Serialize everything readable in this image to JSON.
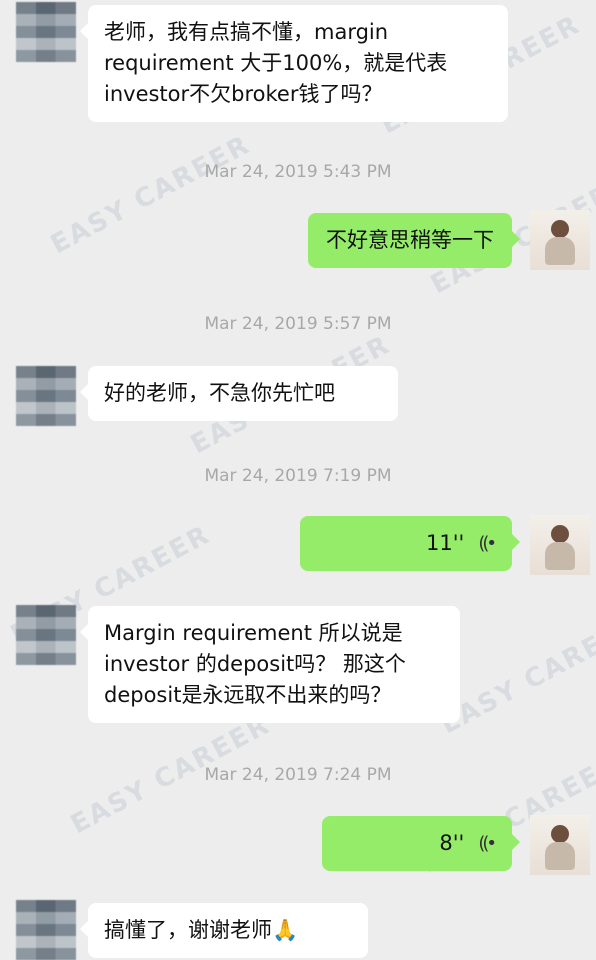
{
  "messages": {
    "m1": "老师，我有点搞不懂，margin\nrequirement 大于100%，就是代表\ninvestor不欠broker钱了吗？",
    "m2": "不好意思稍等一下",
    "m3": "好的老师，不急你先忙吧",
    "m4_duration": "11''",
    "m5": "Margin requirement 所以说是\ninvestor 的deposit吗？ 那这个\ndeposit是永远取不出来的吗？",
    "m6_duration": "8''",
    "m7": "搞懂了，谢谢老师🙏"
  },
  "timestamps": {
    "t1": "Mar 24, 2019 5:43 PM",
    "t2": "Mar 24, 2019 5:57 PM",
    "t3": "Mar 24, 2019 7:19 PM",
    "t4": "Mar 24, 2019 7:24 PM"
  },
  "watermark_text": "EASY CAREER",
  "icons": {
    "voice": "voice-wave-icon"
  },
  "colors": {
    "background": "#ededed",
    "sent_bubble": "#95ec69",
    "received_bubble": "#ffffff",
    "timestamp": "#a8a8a8"
  }
}
